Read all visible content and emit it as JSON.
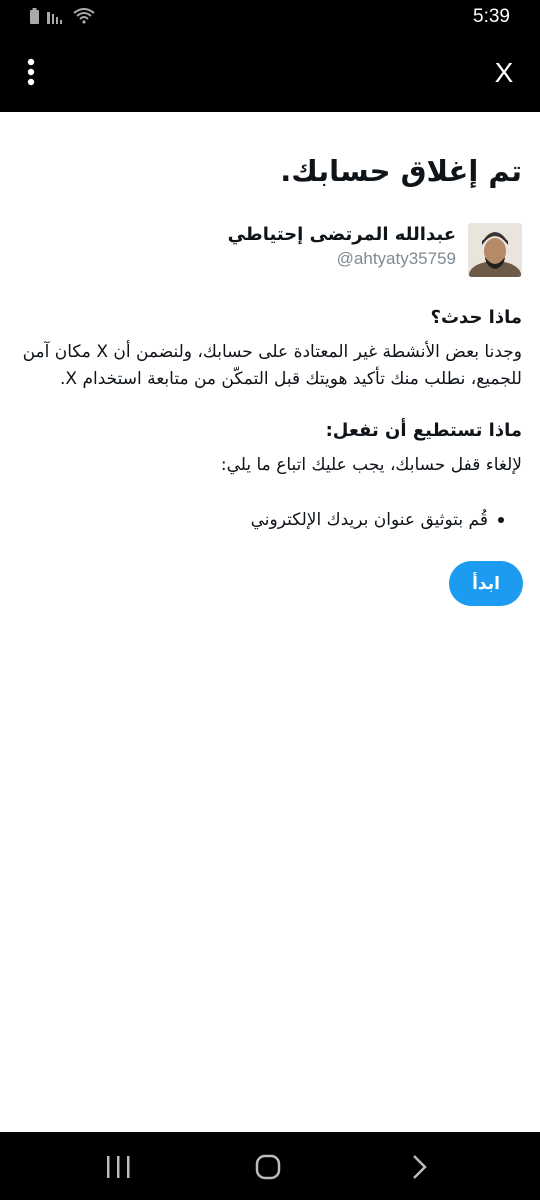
{
  "status_bar": {
    "time": "5:39",
    "icons": [
      "battery-icon",
      "signal-icon",
      "wifi-icon"
    ]
  },
  "app_bar": {
    "icons": [
      "more-vertical-icon",
      "close-icon"
    ],
    "close_label": "X"
  },
  "page": {
    "title": "تم إغلاق حسابك.",
    "user": {
      "name": "عبدالله المرتضى إحتياطي",
      "handle": "@ahtyaty35759"
    },
    "what_happened": {
      "heading": "ماذا حدث؟",
      "body": "وجدنا بعض الأنشطة غير المعتادة على حسابك، ولنضمن أن X مكان آمن للجميع، نطلب منك تأكيد هويتك قبل التمكّن من متابعة استخدام X."
    },
    "what_to_do": {
      "heading": "ماذا تستطيع أن تفعل:",
      "intro": "لإلغاء قفل حسابك، يجب عليك اتباع ما يلي:",
      "steps": [
        "قُم بتوثيق عنوان بريدك الإلكتروني"
      ]
    },
    "start_button": "ابدأ"
  },
  "nav_bar": {
    "icons": [
      "recent-apps-icon",
      "home-icon",
      "back-icon"
    ]
  },
  "colors": {
    "accent": "#1d9bf0",
    "bars": "#000000",
    "text": "#0f1419",
    "muted": "#7f8a93"
  }
}
